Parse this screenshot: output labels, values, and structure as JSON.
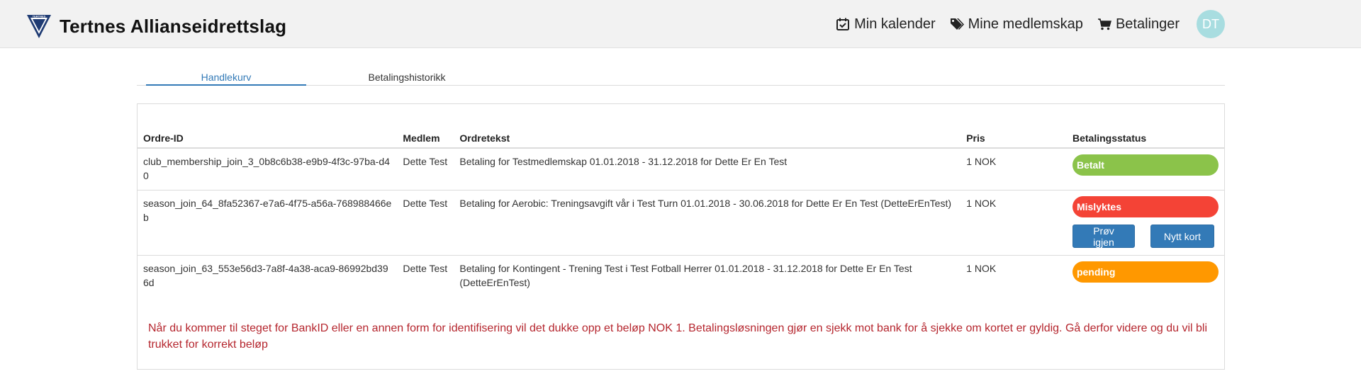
{
  "header": {
    "brand_name": "Tertnes Allianseidrettslag",
    "logo_text": "TERTNES",
    "nav": [
      {
        "label": "Min kalender",
        "icon": "calendar-check-icon"
      },
      {
        "label": "Mine medlemskap",
        "icon": "tags-icon"
      },
      {
        "label": "Betalinger",
        "icon": "shopping-cart-icon"
      }
    ],
    "avatar_initials": "DT"
  },
  "tabs": [
    {
      "label": "Handlekurv",
      "active": true
    },
    {
      "label": "Betalingshistorikk",
      "active": false
    }
  ],
  "table": {
    "columns": [
      "Ordre-ID",
      "Medlem",
      "Ordretekst",
      "Pris",
      "Betalingsstatus"
    ],
    "rows": [
      {
        "order_id": "club_membership_join_3_0b8c6b38-e9b9-4f3c-97ba-d40",
        "member": "Dette Test",
        "text": "Betaling for Testmedlemskap 01.01.2018 - 31.12.2018 for Dette Er En Test",
        "price": "1 NOK",
        "status": "Betalt"
      },
      {
        "order_id": "season_join_64_8fa52367-e7a6-4f75-a56a-768988466eb",
        "member": "Dette Test",
        "text": "Betaling for Aerobic: Treningsavgift vår i Test Turn 01.01.2018 - 30.06.2018 for Dette Er En Test (DetteErEnTest)",
        "price": "1 NOK",
        "status": "Mislyktes",
        "retry_label": "Prøv igjen",
        "new_card_label": "Nytt kort"
      },
      {
        "order_id": "season_join_63_553e56d3-7a8f-4a38-aca9-86992bd396d",
        "member": "Dette Test",
        "text": "Betaling for Kontingent - Trening Test i Test Fotball Herrer 01.01.2018 - 31.12.2018 for Dette Er En Test (DetteErEnTest)",
        "price": "1 NOK",
        "status": "pending"
      }
    ]
  },
  "notice": "Når du kommer til steget for BankID eller en annen form for identifisering vil det dukke opp et beløp NOK 1. Betalingsløsningen gjør en sjekk mot bank for å sjekke om kortet er gyldig. Gå derfor videre og du vil bli trukket for korrekt beløp",
  "colors": {
    "accent": "#337ab7",
    "status_paid": "#8bc34a",
    "status_failed": "#f44336",
    "status_pending": "#ff9800",
    "notice_text": "#b5262e",
    "avatar_bg": "#a8dde0"
  }
}
